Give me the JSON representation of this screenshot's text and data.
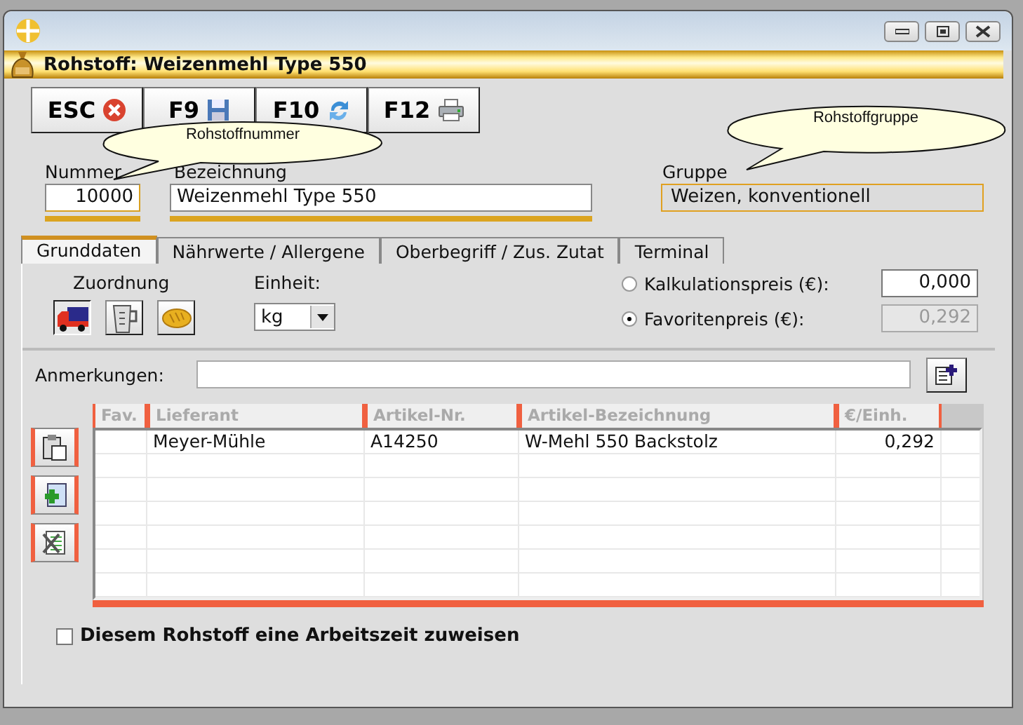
{
  "window": {
    "title": "Rohstoff: Weizenmehl Type 550"
  },
  "toolbar": [
    {
      "label": "ESC",
      "kind": "cancel"
    },
    {
      "label": "F9",
      "kind": "save"
    },
    {
      "label": "F10",
      "kind": "refresh"
    },
    {
      "label": "F12",
      "kind": "print"
    }
  ],
  "fields": {
    "nummer": {
      "label": "Nummer",
      "value": "10000"
    },
    "bezeichnung": {
      "label": "Bezeichnung",
      "value": "Weizenmehl Type 550"
    },
    "gruppe": {
      "label": "Gruppe",
      "value": "Weizen, konventionell"
    }
  },
  "tooltips": [
    {
      "text": "Rohstoffnummer",
      "kind": "nummer"
    },
    {
      "text": "Rohstoffgruppe",
      "kind": "gruppe"
    }
  ],
  "tabs": [
    {
      "label": "Grunddaten",
      "selected": true
    },
    {
      "label": "Nährwerte / Allergene",
      "selected": false
    },
    {
      "label": "Oberbegriff / Zus. Zutat",
      "selected": false
    },
    {
      "label": "Terminal",
      "selected": false
    }
  ],
  "zuordnung": {
    "label": "Zuordnung",
    "items": [
      {
        "kind": "truck",
        "selected": true
      },
      {
        "kind": "jug",
        "selected": false
      },
      {
        "kind": "bread",
        "selected": false
      }
    ]
  },
  "einheit": {
    "label": "Einheit:",
    "value": "kg"
  },
  "prices": [
    {
      "label": "Kalkulationspreis (€):",
      "selected": false,
      "value": "0,000",
      "disabled": false
    },
    {
      "label": "Favoritenpreis (€):",
      "selected": true,
      "value": "0,292",
      "disabled": true
    }
  ],
  "anmerkungen": {
    "label": "Anmerkungen:"
  },
  "table": {
    "columns": [
      "Fav.",
      "Lieferant",
      "Artikel-Nr.",
      "Artikel-Bezeichnung",
      "€/Einh."
    ],
    "rows": [
      {
        "cells": [
          "",
          "Meyer-Mühle",
          "A14250",
          "W-Mehl 550 Backstolz",
          "0,292"
        ]
      }
    ]
  },
  "arbeitszeit": {
    "label": "Diesem Rohstoff eine Arbeitszeit zuweisen",
    "checked": false
  }
}
